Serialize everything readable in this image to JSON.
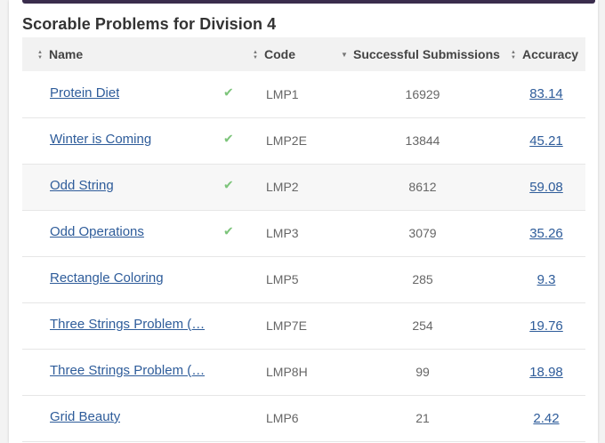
{
  "header": {
    "title": "Scorable Problems for Division 4"
  },
  "table": {
    "columns": {
      "name": "Name",
      "code": "Code",
      "submissions": "Successful Submissions",
      "accuracy": "Accuracy"
    },
    "rows": [
      {
        "name": "Protein Diet",
        "solved": true,
        "code": "LMP1",
        "submissions": "16929",
        "accuracy": "83.14"
      },
      {
        "name": "Winter is Coming",
        "solved": true,
        "code": "LMP2E",
        "submissions": "13844",
        "accuracy": "45.21"
      },
      {
        "name": "Odd String",
        "solved": true,
        "code": "LMP2",
        "submissions": "8612",
        "accuracy": "59.08"
      },
      {
        "name": "Odd Operations",
        "solved": true,
        "code": "LMP3",
        "submissions": "3079",
        "accuracy": "35.26"
      },
      {
        "name": "Rectangle Coloring",
        "solved": false,
        "code": "LMP5",
        "submissions": "285",
        "accuracy": "9.3"
      },
      {
        "name": "Three Strings Problem (…",
        "solved": false,
        "code": "LMP7E",
        "submissions": "254",
        "accuracy": "19.76"
      },
      {
        "name": "Three Strings Problem (…",
        "solved": false,
        "code": "LMP8H",
        "submissions": "99",
        "accuracy": "18.98"
      },
      {
        "name": "Grid Beauty",
        "solved": false,
        "code": "LMP6",
        "submissions": "21",
        "accuracy": "2.42"
      }
    ]
  },
  "colors": {
    "top_bar": "#3a2d4d",
    "link": "#2e5c9a",
    "check": "#7cc47a"
  },
  "icons": {
    "solved": "check-icon",
    "sort": "sort-icon",
    "sort_desc": "sort-desc-icon"
  }
}
